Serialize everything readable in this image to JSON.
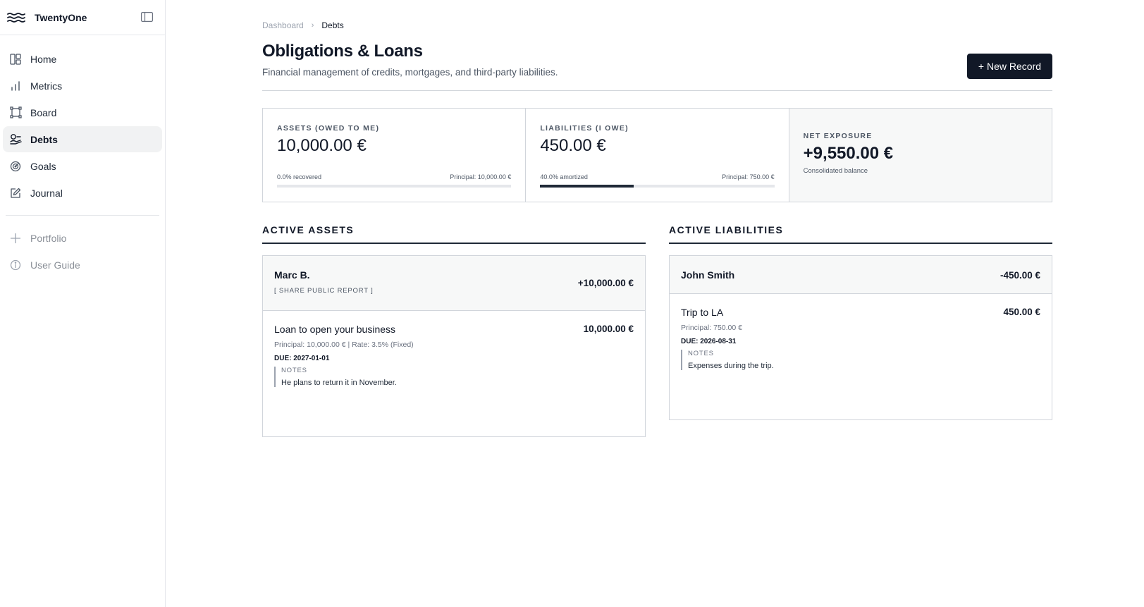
{
  "app": {
    "name": "TwentyOne"
  },
  "sidebar": {
    "items": [
      {
        "label": "Home",
        "icon": "layout-icon"
      },
      {
        "label": "Metrics",
        "icon": "bar-chart-icon"
      },
      {
        "label": "Board",
        "icon": "board-icon"
      },
      {
        "label": "Debts",
        "icon": "debts-icon",
        "active": true
      },
      {
        "label": "Goals",
        "icon": "target-icon"
      },
      {
        "label": "Journal",
        "icon": "edit-icon"
      }
    ],
    "secondary": [
      {
        "label": "Portfolio",
        "icon": "plus-icon"
      },
      {
        "label": "User Guide",
        "icon": "info-icon"
      }
    ]
  },
  "breadcrumb": {
    "parent": "Dashboard",
    "current": "Debts"
  },
  "header": {
    "title": "Obligations & Loans",
    "subtitle": "Financial management of credits, mortgages, and third-party liabilities.",
    "new_button": "+ New Record"
  },
  "stats": {
    "assets": {
      "label": "ASSETS (OWED TO ME)",
      "value": "10,000.00 €",
      "progress_text": "0.0% recovered",
      "principal": "Principal: 10,000.00 €",
      "progress": 0.0
    },
    "liabilities": {
      "label": "LIABILITIES (I OWE)",
      "value": "450.00 €",
      "progress_text": "40.0% amortized",
      "principal": "Principal: 750.00 €",
      "progress": 0.4
    },
    "net": {
      "label": "NET EXPOSURE",
      "value": "+9,550.00 €",
      "caption": "Consolidated balance"
    }
  },
  "active_assets": {
    "heading": "ACTIVE ASSETS",
    "person": "Marc B.",
    "total": "+10,000.00 €",
    "share": "[ SHARE PUBLIC REPORT ]",
    "item": {
      "title": "Loan to open your business",
      "amount": "10,000.00 €",
      "principal": "Principal: 10,000.00 € | Rate: 3.5% (Fixed)",
      "due": "DUE: 2027-01-01",
      "notes_label": "NOTES",
      "notes": "He plans to return it in November."
    }
  },
  "active_liabilities": {
    "heading": "ACTIVE LIABILITIES",
    "person": "John Smith",
    "total": "-450.00 €",
    "item": {
      "title": "Trip to LA",
      "amount": "450.00 €",
      "principal": "Principal: 750.00 €",
      "due": "DUE: 2026-08-31",
      "notes_label": "NOTES",
      "notes": "Expenses during the trip."
    }
  },
  "colors": {
    "primary": "#111827",
    "border": "#d1d5db",
    "muted_bg": "#f7f8f8"
  }
}
